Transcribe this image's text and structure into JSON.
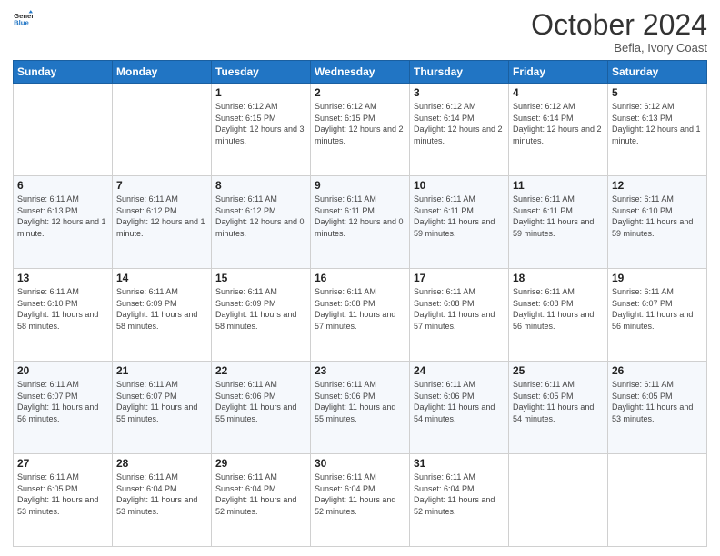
{
  "header": {
    "logo_line1": "General",
    "logo_line2": "Blue",
    "title": "October 2024",
    "subtitle": "Befla, Ivory Coast"
  },
  "days_of_week": [
    "Sunday",
    "Monday",
    "Tuesday",
    "Wednesday",
    "Thursday",
    "Friday",
    "Saturday"
  ],
  "weeks": [
    [
      {
        "day": "",
        "info": ""
      },
      {
        "day": "",
        "info": ""
      },
      {
        "day": "1",
        "info": "Sunrise: 6:12 AM\nSunset: 6:15 PM\nDaylight: 12 hours and 3 minutes."
      },
      {
        "day": "2",
        "info": "Sunrise: 6:12 AM\nSunset: 6:15 PM\nDaylight: 12 hours and 2 minutes."
      },
      {
        "day": "3",
        "info": "Sunrise: 6:12 AM\nSunset: 6:14 PM\nDaylight: 12 hours and 2 minutes."
      },
      {
        "day": "4",
        "info": "Sunrise: 6:12 AM\nSunset: 6:14 PM\nDaylight: 12 hours and 2 minutes."
      },
      {
        "day": "5",
        "info": "Sunrise: 6:12 AM\nSunset: 6:13 PM\nDaylight: 12 hours and 1 minute."
      }
    ],
    [
      {
        "day": "6",
        "info": "Sunrise: 6:11 AM\nSunset: 6:13 PM\nDaylight: 12 hours and 1 minute."
      },
      {
        "day": "7",
        "info": "Sunrise: 6:11 AM\nSunset: 6:12 PM\nDaylight: 12 hours and 1 minute."
      },
      {
        "day": "8",
        "info": "Sunrise: 6:11 AM\nSunset: 6:12 PM\nDaylight: 12 hours and 0 minutes."
      },
      {
        "day": "9",
        "info": "Sunrise: 6:11 AM\nSunset: 6:11 PM\nDaylight: 12 hours and 0 minutes."
      },
      {
        "day": "10",
        "info": "Sunrise: 6:11 AM\nSunset: 6:11 PM\nDaylight: 11 hours and 59 minutes."
      },
      {
        "day": "11",
        "info": "Sunrise: 6:11 AM\nSunset: 6:11 PM\nDaylight: 11 hours and 59 minutes."
      },
      {
        "day": "12",
        "info": "Sunrise: 6:11 AM\nSunset: 6:10 PM\nDaylight: 11 hours and 59 minutes."
      }
    ],
    [
      {
        "day": "13",
        "info": "Sunrise: 6:11 AM\nSunset: 6:10 PM\nDaylight: 11 hours and 58 minutes."
      },
      {
        "day": "14",
        "info": "Sunrise: 6:11 AM\nSunset: 6:09 PM\nDaylight: 11 hours and 58 minutes."
      },
      {
        "day": "15",
        "info": "Sunrise: 6:11 AM\nSunset: 6:09 PM\nDaylight: 11 hours and 58 minutes."
      },
      {
        "day": "16",
        "info": "Sunrise: 6:11 AM\nSunset: 6:08 PM\nDaylight: 11 hours and 57 minutes."
      },
      {
        "day": "17",
        "info": "Sunrise: 6:11 AM\nSunset: 6:08 PM\nDaylight: 11 hours and 57 minutes."
      },
      {
        "day": "18",
        "info": "Sunrise: 6:11 AM\nSunset: 6:08 PM\nDaylight: 11 hours and 56 minutes."
      },
      {
        "day": "19",
        "info": "Sunrise: 6:11 AM\nSunset: 6:07 PM\nDaylight: 11 hours and 56 minutes."
      }
    ],
    [
      {
        "day": "20",
        "info": "Sunrise: 6:11 AM\nSunset: 6:07 PM\nDaylight: 11 hours and 56 minutes."
      },
      {
        "day": "21",
        "info": "Sunrise: 6:11 AM\nSunset: 6:07 PM\nDaylight: 11 hours and 55 minutes."
      },
      {
        "day": "22",
        "info": "Sunrise: 6:11 AM\nSunset: 6:06 PM\nDaylight: 11 hours and 55 minutes."
      },
      {
        "day": "23",
        "info": "Sunrise: 6:11 AM\nSunset: 6:06 PM\nDaylight: 11 hours and 55 minutes."
      },
      {
        "day": "24",
        "info": "Sunrise: 6:11 AM\nSunset: 6:06 PM\nDaylight: 11 hours and 54 minutes."
      },
      {
        "day": "25",
        "info": "Sunrise: 6:11 AM\nSunset: 6:05 PM\nDaylight: 11 hours and 54 minutes."
      },
      {
        "day": "26",
        "info": "Sunrise: 6:11 AM\nSunset: 6:05 PM\nDaylight: 11 hours and 53 minutes."
      }
    ],
    [
      {
        "day": "27",
        "info": "Sunrise: 6:11 AM\nSunset: 6:05 PM\nDaylight: 11 hours and 53 minutes."
      },
      {
        "day": "28",
        "info": "Sunrise: 6:11 AM\nSunset: 6:04 PM\nDaylight: 11 hours and 53 minutes."
      },
      {
        "day": "29",
        "info": "Sunrise: 6:11 AM\nSunset: 6:04 PM\nDaylight: 11 hours and 52 minutes."
      },
      {
        "day": "30",
        "info": "Sunrise: 6:11 AM\nSunset: 6:04 PM\nDaylight: 11 hours and 52 minutes."
      },
      {
        "day": "31",
        "info": "Sunrise: 6:11 AM\nSunset: 6:04 PM\nDaylight: 11 hours and 52 minutes."
      },
      {
        "day": "",
        "info": ""
      },
      {
        "day": "",
        "info": ""
      }
    ]
  ]
}
